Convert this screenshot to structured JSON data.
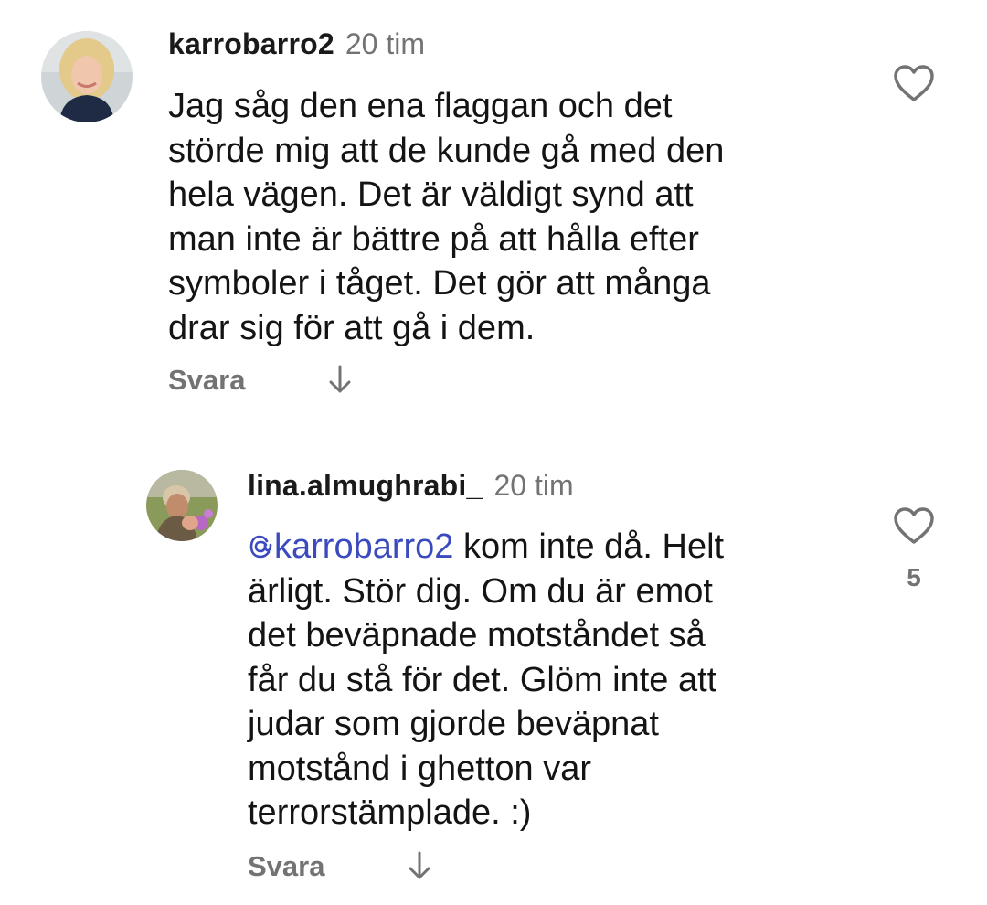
{
  "comments": [
    {
      "username": "karrobarro2",
      "time": "20 tim",
      "lines": [
        "Jag såg den ena flaggan och det",
        "störde mig att de kunde gå med den",
        "hela vägen. Det är väldigt synd att",
        "man inte är bättre på att hålla efter",
        "symboler i tåget. Det gör att många",
        "drar sig för att gå i dem."
      ],
      "reply_label": "Svara",
      "like_count": ""
    },
    {
      "username": "lina.almughrabi_",
      "time": "20 tim",
      "mention": "karrobarro2",
      "first_line_rest": " kom inte då. Helt",
      "lines": [
        "ärligt. Stör dig. Om du är emot",
        "det beväpnade motståndet så",
        "får du stå för det. Glöm inte att",
        "judar som gjorde beväpnat",
        "motstånd i ghetton var",
        "terrorstämplade. :)"
      ],
      "reply_label": "Svara",
      "like_count": "5"
    }
  ],
  "icons": {
    "like": "heart-outline-icon",
    "expand": "arrow-down-icon",
    "mention_prefix": "threads-at-icon"
  },
  "colors": {
    "text": "#141414",
    "secondary": "#737373",
    "mention": "#3b4bbf",
    "background": "#ffffff"
  }
}
